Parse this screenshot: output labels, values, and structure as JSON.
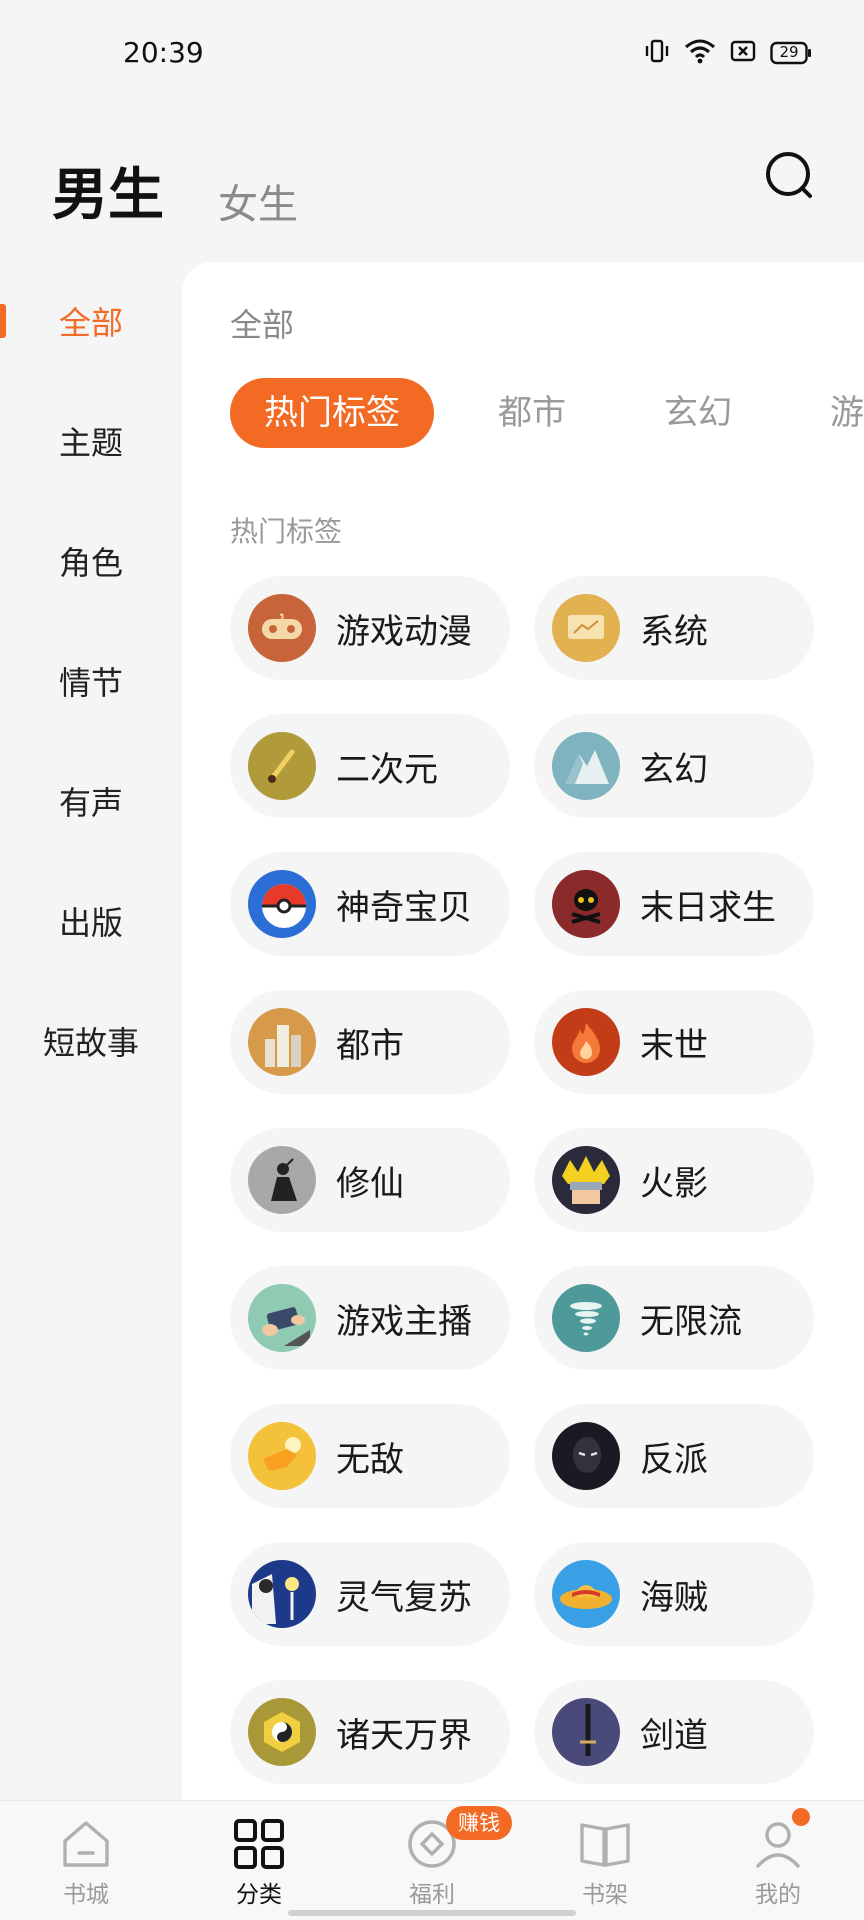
{
  "status_bar": {
    "time": "20:39",
    "battery": "29",
    "icons": [
      "vibrate-icon",
      "wifi-icon",
      "sim-icon",
      "battery-icon"
    ]
  },
  "header": {
    "tab_male": "男生",
    "tab_female": "女生",
    "search_icon": "search-icon"
  },
  "sidebar": {
    "items": [
      {
        "label": "全部",
        "active": true
      },
      {
        "label": "主题",
        "active": false
      },
      {
        "label": "角色",
        "active": false
      },
      {
        "label": "情节",
        "active": false
      },
      {
        "label": "有声",
        "active": false
      },
      {
        "label": "出版",
        "active": false
      },
      {
        "label": "短故事",
        "active": false
      }
    ]
  },
  "content": {
    "title": "全部",
    "chips": [
      {
        "label": "热门标签",
        "active": true
      },
      {
        "label": "都市",
        "active": false
      },
      {
        "label": "玄幻",
        "active": false
      },
      {
        "label": "游戏",
        "active": false
      }
    ],
    "section_label": "热门标签",
    "tags": [
      {
        "label": "游戏动漫",
        "icon": "gamepad-icon",
        "color": "#c8643a"
      },
      {
        "label": "系统",
        "icon": "screen-icon",
        "color": "#e3b250"
      },
      {
        "label": "二次元",
        "icon": "brush-icon",
        "color": "#b09a3a"
      },
      {
        "label": "玄幻",
        "icon": "mountain-icon",
        "color": "#7fb3c0"
      },
      {
        "label": "神奇宝贝",
        "icon": "pokeball-icon",
        "color": "#2b6fd6"
      },
      {
        "label": "末日求生",
        "icon": "skull-icon",
        "color": "#8a2a2a"
      },
      {
        "label": "都市",
        "icon": "city-icon",
        "color": "#d79a4a"
      },
      {
        "label": "末世",
        "icon": "fire-icon",
        "color": "#c23c18"
      },
      {
        "label": "修仙",
        "icon": "cultivator-icon",
        "color": "#a8a8a8"
      },
      {
        "label": "火影",
        "icon": "ninja-icon",
        "color": "#2a2a3a"
      },
      {
        "label": "游戏主播",
        "icon": "phone-game-icon",
        "color": "#8fcab2"
      },
      {
        "label": "无限流",
        "icon": "tornado-icon",
        "color": "#4e9a9a"
      },
      {
        "label": "无敌",
        "icon": "fist-icon",
        "color": "#f4c13a"
      },
      {
        "label": "反派",
        "icon": "villain-icon",
        "color": "#1a1a22"
      },
      {
        "label": "灵气复苏",
        "icon": "spirit-icon",
        "color": "#1d3a8a"
      },
      {
        "label": "海贼",
        "icon": "strawhat-icon",
        "color": "#3aa0e6"
      },
      {
        "label": "诸天万界",
        "icon": "taiji-icon",
        "color": "#a89838"
      },
      {
        "label": "剑道",
        "icon": "sword-icon",
        "color": "#4a4a7a"
      }
    ]
  },
  "bottom_nav": {
    "items": [
      {
        "label": "书城",
        "icon": "home-icon"
      },
      {
        "label": "分类",
        "icon": "category-icon",
        "active": true
      },
      {
        "label": "福利",
        "icon": "coin-icon"
      },
      {
        "label": "书架",
        "icon": "book-icon"
      },
      {
        "label": "我的",
        "icon": "user-icon"
      }
    ],
    "earn_badge": "赚钱"
  },
  "colors": {
    "accent": "#f26a24",
    "panel_bg": "#ffffff",
    "page_bg": "#f5f5f5"
  }
}
